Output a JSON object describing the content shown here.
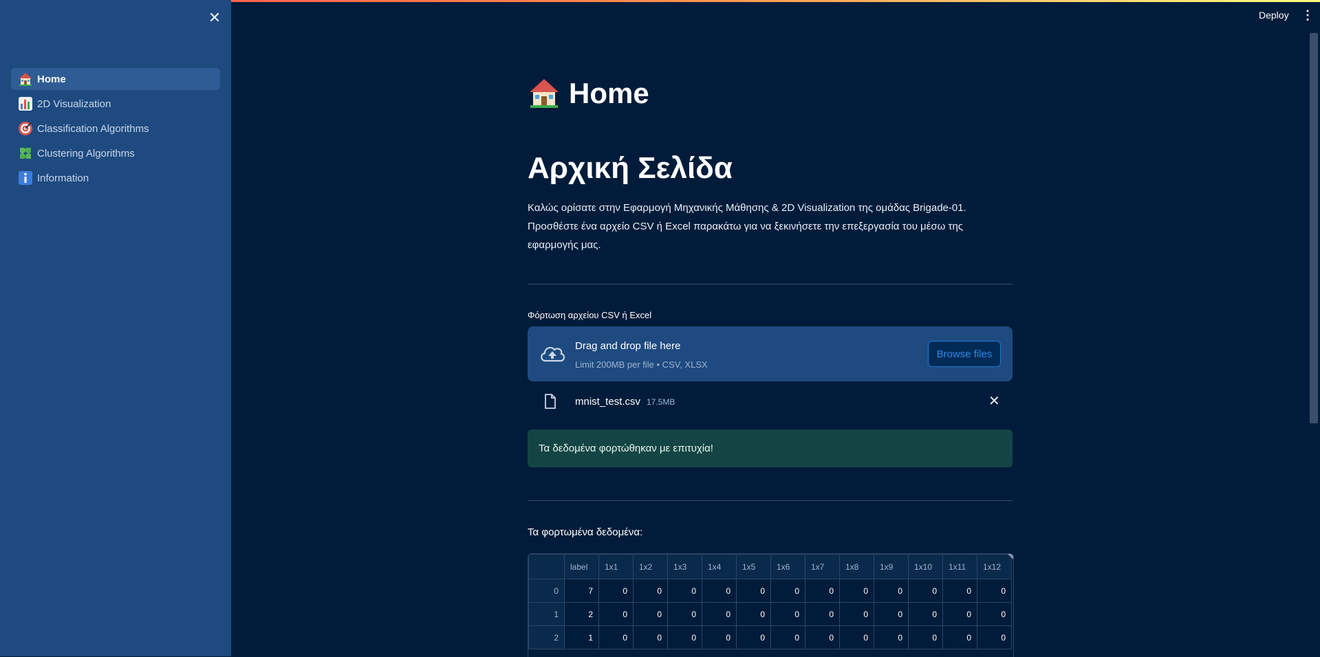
{
  "app": {
    "deploy_label": "Deploy",
    "menu_glyph": "⋮",
    "sidebar_close_glyph": "✕",
    "accent": "#2b8be8",
    "sidebar_bg": "#1e4a80",
    "page_bg": "#011c3a"
  },
  "sidebar": {
    "items": [
      {
        "label": "Home",
        "icon": "house-icon",
        "active": true
      },
      {
        "label": "2D Visualization",
        "icon": "bar-chart-icon",
        "active": false
      },
      {
        "label": "Classification Algorithms",
        "icon": "target-icon",
        "active": false
      },
      {
        "label": "Clustering Algorithms",
        "icon": "puzzle-icon",
        "active": false
      },
      {
        "label": "Information",
        "icon": "info-icon",
        "active": false
      }
    ]
  },
  "main": {
    "title": "Home",
    "heading": "Αρχική Σελίδα",
    "intro": "Καλώς ορίσατε στην Εφαρμογή Μηχανικής Μάθησης & 2D Visualization της ομάδας Brigade-01. Προσθέστε ένα αρχείο CSV ή Excel παρακάτω για να ξεκινήσετε την επεξεργασία του μέσω της εφαρμογής μας.",
    "upload": {
      "label": "Φόρτωση αρχείου CSV ή Excel",
      "drop_title": "Drag and drop file here",
      "drop_sub": "Limit 200MB per file • CSV, XLSX",
      "browse_label": "Browse files",
      "file_name": "mnist_test.csv",
      "file_size": "17.5MB",
      "remove_glyph": "✕"
    },
    "success_message": "Τα δεδομένα φορτώθηκαν με επιτυχία!",
    "data_label": "Τα φορτωμένα δεδομένα:",
    "table": {
      "columns": [
        "",
        "label",
        "1x1",
        "1x2",
        "1x3",
        "1x4",
        "1x5",
        "1x6",
        "1x7",
        "1x8",
        "1x9",
        "1x10",
        "1x11",
        "1x12"
      ],
      "rows": [
        [
          "0",
          "7",
          "0",
          "0",
          "0",
          "0",
          "0",
          "0",
          "0",
          "0",
          "0",
          "0",
          "0",
          "0"
        ],
        [
          "1",
          "2",
          "0",
          "0",
          "0",
          "0",
          "0",
          "0",
          "0",
          "0",
          "0",
          "0",
          "0",
          "0"
        ],
        [
          "2",
          "1",
          "0",
          "0",
          "0",
          "0",
          "0",
          "0",
          "0",
          "0",
          "0",
          "0",
          "0",
          "0"
        ]
      ]
    }
  }
}
